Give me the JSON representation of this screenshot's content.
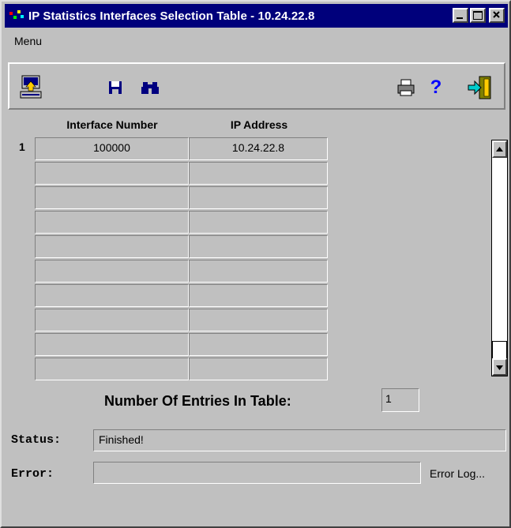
{
  "window": {
    "title": "IP Statistics Interfaces Selection Table - 10.24.22.8"
  },
  "menu": {
    "items": [
      "Menu"
    ]
  },
  "toolbar": {
    "left_icons": [
      "load-icon",
      "save-icon",
      "find-icon"
    ],
    "right_icons": [
      "print-icon",
      "help-icon",
      "exit-icon"
    ]
  },
  "table": {
    "columns": [
      "Interface Number",
      "IP Address"
    ],
    "rows": [
      {
        "num": "1",
        "interface_number": "100000",
        "ip_address": "10.24.22.8"
      },
      {
        "num": "",
        "interface_number": "",
        "ip_address": ""
      },
      {
        "num": "",
        "interface_number": "",
        "ip_address": ""
      },
      {
        "num": "",
        "interface_number": "",
        "ip_address": ""
      },
      {
        "num": "",
        "interface_number": "",
        "ip_address": ""
      },
      {
        "num": "",
        "interface_number": "",
        "ip_address": ""
      },
      {
        "num": "",
        "interface_number": "",
        "ip_address": ""
      },
      {
        "num": "",
        "interface_number": "",
        "ip_address": ""
      },
      {
        "num": "",
        "interface_number": "",
        "ip_address": ""
      },
      {
        "num": "",
        "interface_number": "",
        "ip_address": ""
      }
    ]
  },
  "entries": {
    "label": "Number Of Entries In Table:",
    "value": "1"
  },
  "status": {
    "label": "Status:",
    "value": "Finished!"
  },
  "error": {
    "label": "Error:",
    "value": "",
    "log_label": "Error Log..."
  }
}
